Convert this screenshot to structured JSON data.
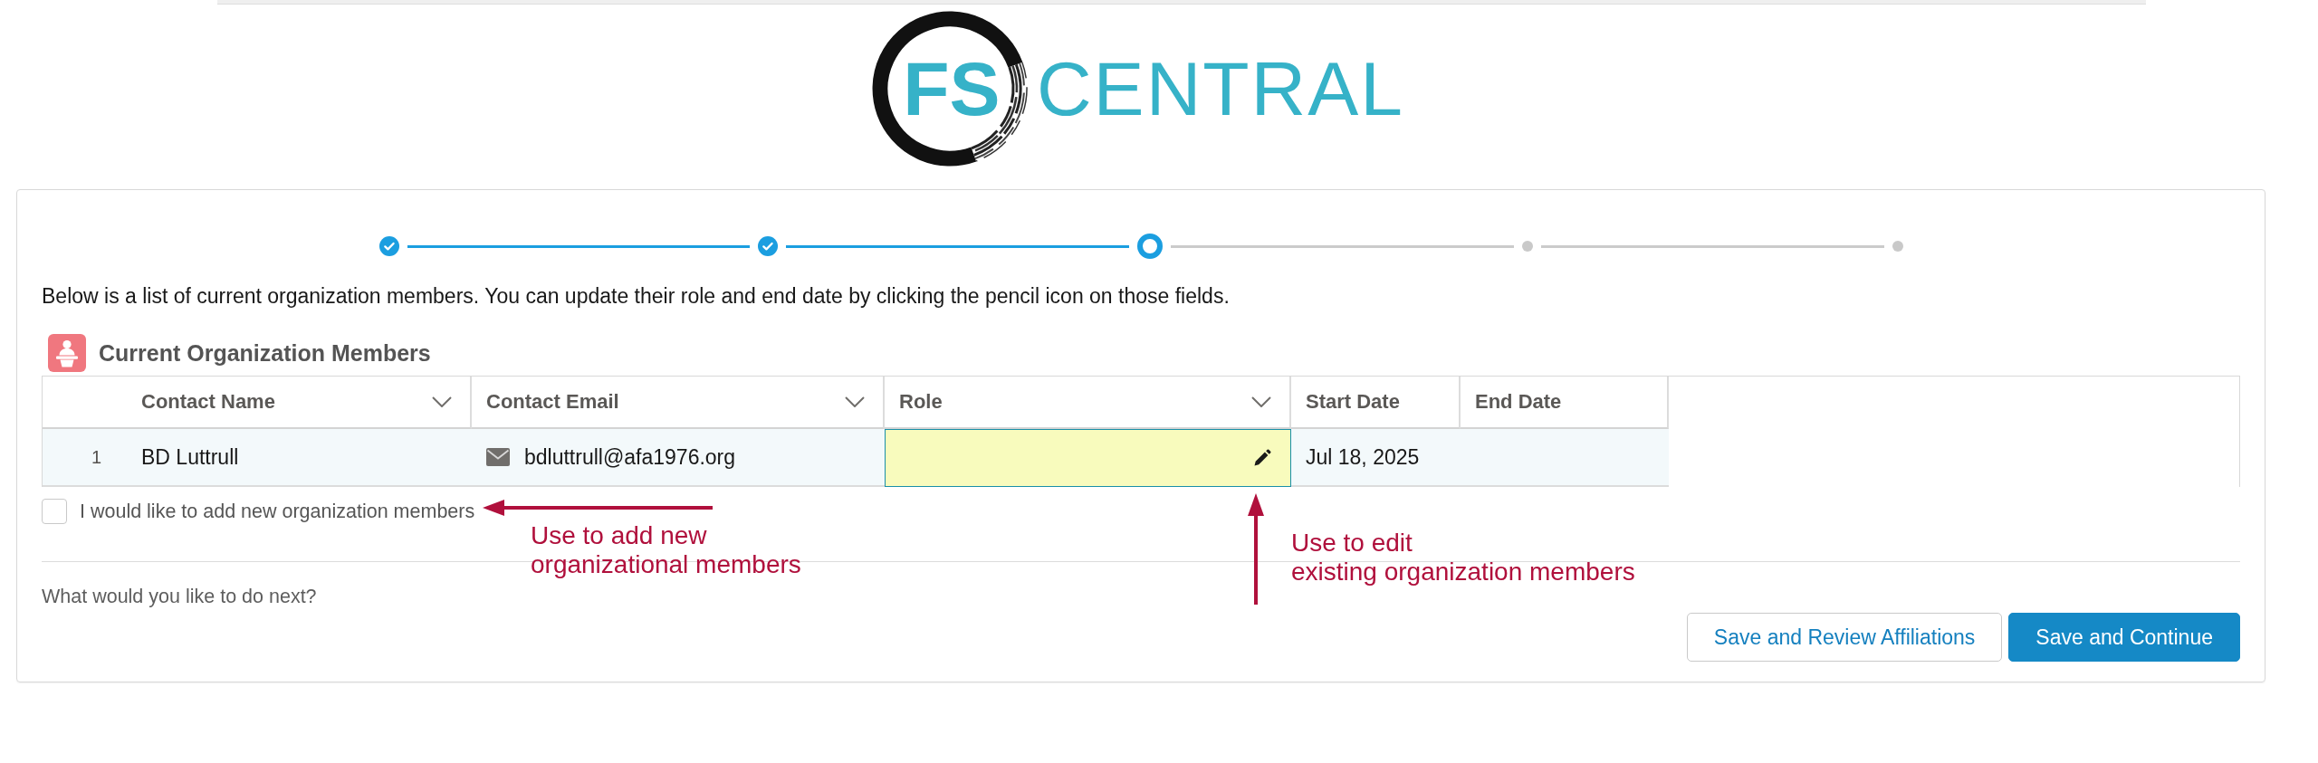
{
  "logo": {
    "mark": "FS",
    "wordmark": "CENTRAL"
  },
  "progress": {
    "steps": [
      {
        "kind": "complete"
      },
      {
        "kind": "complete"
      },
      {
        "kind": "current"
      },
      {
        "kind": "upcoming"
      },
      {
        "kind": "upcoming"
      }
    ]
  },
  "intro": "Below is a list of current organization members. You can update their role and end date by clicking the pencil icon on those fields.",
  "section": {
    "title": "Current Organization Members"
  },
  "table": {
    "columns": [
      {
        "label": "Contact Name",
        "menu": true
      },
      {
        "label": "Contact Email",
        "menu": true
      },
      {
        "label": "Role",
        "menu": true
      },
      {
        "label": "Start Date",
        "menu": false
      },
      {
        "label": "End Date",
        "menu": false
      }
    ],
    "rows": [
      {
        "number": "1",
        "cells": [
          {
            "kind": "text",
            "text": "BD Luttrull"
          },
          {
            "kind": "email",
            "text": "bdluttrull@afa1976.org"
          },
          {
            "kind": "editing"
          },
          {
            "kind": "text",
            "text": "Jul 18, 2025"
          },
          {
            "kind": "blank"
          }
        ]
      }
    ]
  },
  "add_members": {
    "label": "I would like to add new organization members",
    "checked": false
  },
  "annotations": [
    {
      "kind": "arrow-left",
      "lines": [
        "Use to add new",
        "organizational members"
      ]
    },
    {
      "kind": "arrow-up",
      "lines": [
        "Use to edit",
        "existing organization members"
      ]
    }
  ],
  "next": {
    "prompt": "What would you like to do next?",
    "buttons": [
      {
        "label": "Save and Review Affiliations",
        "kind": "secondary"
      },
      {
        "label": "Save and Continue",
        "kind": "primary"
      }
    ]
  }
}
